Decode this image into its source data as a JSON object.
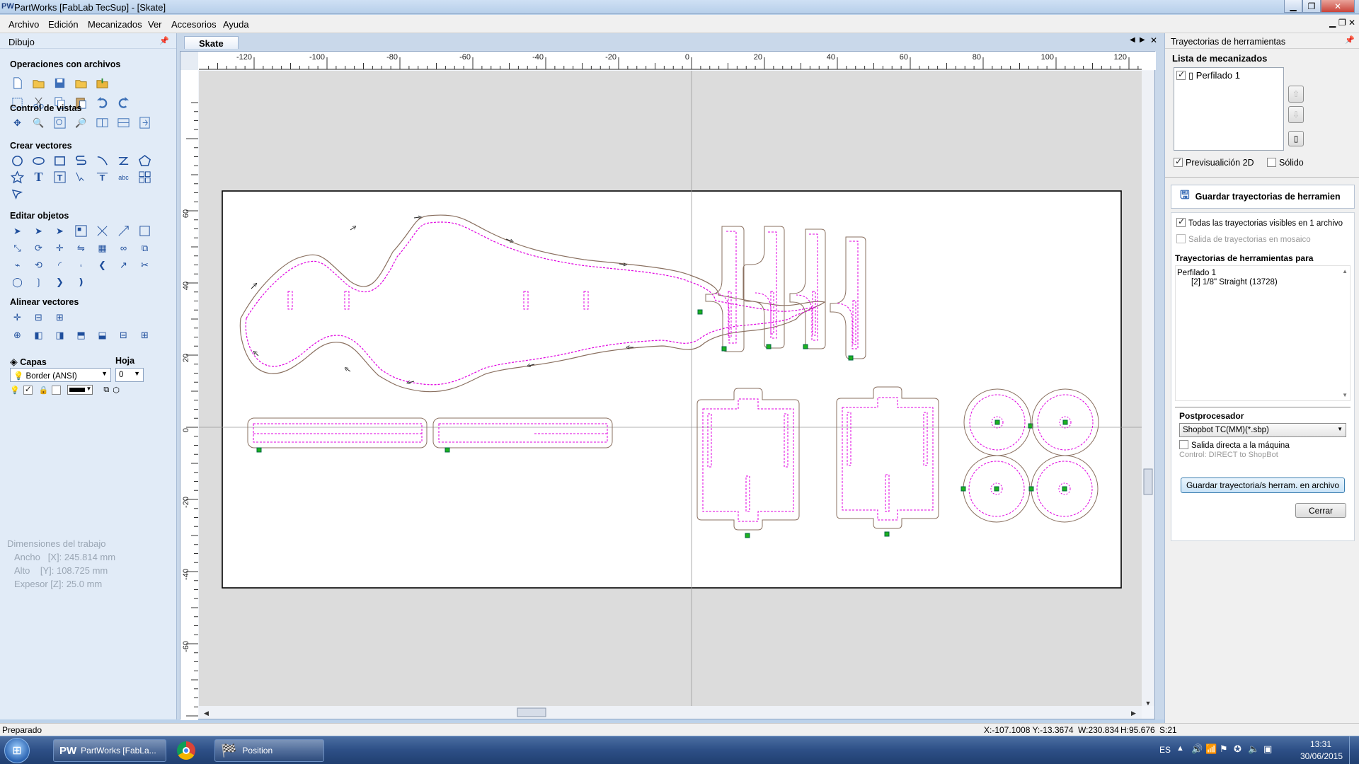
{
  "window": {
    "logo": "PW",
    "title": "PartWorks [FabLab TecSup] - [Skate]"
  },
  "menu": [
    "Archivo",
    "Edición",
    "Mecanizados",
    "Ver",
    "Accesorios",
    "Ayuda"
  ],
  "left_panel": {
    "title": "Dibujo",
    "sections": {
      "files": "Operaciones con archivos",
      "views": "Control de vistas",
      "create": "Crear vectores",
      "edit": "Editar objetos",
      "align": "Alinear vectores"
    },
    "layers": {
      "label": "Capas",
      "sheet_label": "Hoja",
      "layer_value": "Border (ANSI)",
      "sheet_value": "0"
    },
    "job_dimensions": {
      "title": "Dimensiones del trabajo",
      "width": "Ancho   [X]: 245.814 mm",
      "height": "Alto    [Y]: 108.725 mm",
      "thickness": "Expesor [Z]: 25.0 mm"
    }
  },
  "document": {
    "tab": "Skate",
    "ruler_x": [
      "-120",
      "-100",
      "-80",
      "-60",
      "-40",
      "-20",
      "0",
      "20",
      "40",
      "60",
      "80",
      "100",
      "120"
    ],
    "ruler_y": [
      "60",
      "40",
      "20",
      "0",
      "-20",
      "-40",
      "-60"
    ]
  },
  "right_panel": {
    "title": "Trayectorias de herramientas",
    "list_title": "Lista de mecanizados",
    "toolpath_item": "Perfilado 1",
    "preview_2d": "Previsualición 2D",
    "solid": "Sólido",
    "save_header": "Guardar trayectorias de herramien",
    "all_visible": "Todas las trayectorias visibles en 1 archivo",
    "tiled_output": "Salida de trayectorias en mosaico",
    "for_label": "Trayectorias de herramientas para",
    "for_list": [
      "Perfilado 1",
      "[2] 1/8\" Straight (13728)"
    ],
    "postprocessor_label": "Postprocesador",
    "postprocessor_value": "Shopbot TC(MM)(*.sbp)",
    "direct_output": "Salida directa a la máquina",
    "control_note": "Control: DIRECT to ShopBot",
    "save_button": "Guardar trayectoria/s herram. en archivo",
    "close_button": "Cerrar"
  },
  "status": {
    "left": "Preparado",
    "coords": "X:-107.1008 Y:-13.3674",
    "width": "W:230.834",
    "height": "H:95.676",
    "selection": "S:21"
  },
  "taskbar": {
    "apps": [
      "PartWorks [FabLa...",
      "Position"
    ],
    "language": "ES",
    "time": "13:31",
    "date": "30/06/2015"
  }
}
